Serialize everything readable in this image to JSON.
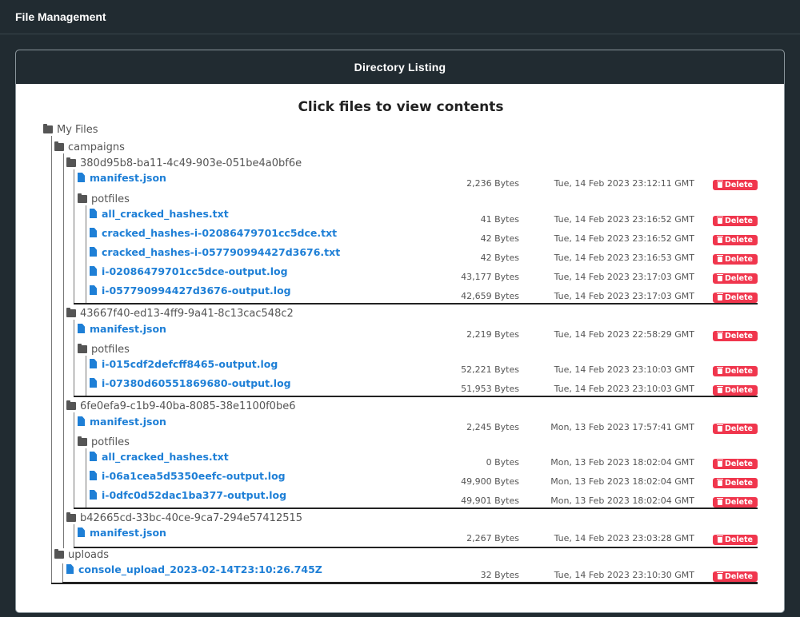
{
  "header": {
    "title": "File Management"
  },
  "card": {
    "title": "Directory Listing",
    "subtitle": "Click files to view contents"
  },
  "root": {
    "label": "My Files"
  },
  "campaigns": {
    "label": "campaigns"
  },
  "uploads": {
    "label": "uploads"
  },
  "delete_label": "Delete",
  "groups": [
    {
      "id": "380d95b8-ba11-4c49-903e-051be4a0bf6e",
      "manifest": {
        "name": "manifest.json",
        "size": "2,236 Bytes",
        "date": "Tue, 14 Feb 2023 23:12:11 GMT"
      },
      "potfiles_label": "potfiles",
      "files": [
        {
          "name": "all_cracked_hashes.txt",
          "size": "41 Bytes",
          "date": "Tue, 14 Feb 2023 23:16:52 GMT"
        },
        {
          "name": "cracked_hashes-i-02086479701cc5dce.txt",
          "size": "42 Bytes",
          "date": "Tue, 14 Feb 2023 23:16:52 GMT"
        },
        {
          "name": "cracked_hashes-i-057790994427d3676.txt",
          "size": "42 Bytes",
          "date": "Tue, 14 Feb 2023 23:16:53 GMT"
        },
        {
          "name": "i-02086479701cc5dce-output.log",
          "size": "43,177 Bytes",
          "date": "Tue, 14 Feb 2023 23:17:03 GMT"
        },
        {
          "name": "i-057790994427d3676-output.log",
          "size": "42,659 Bytes",
          "date": "Tue, 14 Feb 2023 23:17:03 GMT"
        }
      ]
    },
    {
      "id": "43667f40-ed13-4ff9-9a41-8c13cac548c2",
      "manifest": {
        "name": "manifest.json",
        "size": "2,219 Bytes",
        "date": "Tue, 14 Feb 2023 22:58:29 GMT"
      },
      "potfiles_label": "potfiles",
      "files": [
        {
          "name": "i-015cdf2defcff8465-output.log",
          "size": "52,221 Bytes",
          "date": "Tue, 14 Feb 2023 23:10:03 GMT"
        },
        {
          "name": "i-07380d60551869680-output.log",
          "size": "51,953 Bytes",
          "date": "Tue, 14 Feb 2023 23:10:03 GMT"
        }
      ]
    },
    {
      "id": "6fe0efa9-c1b9-40ba-8085-38e1100f0be6",
      "manifest": {
        "name": "manifest.json",
        "size": "2,245 Bytes",
        "date": "Mon, 13 Feb 2023 17:57:41 GMT"
      },
      "potfiles_label": "potfiles",
      "files": [
        {
          "name": "all_cracked_hashes.txt",
          "size": "0 Bytes",
          "date": "Mon, 13 Feb 2023 18:02:04 GMT"
        },
        {
          "name": "i-06a1cea5d5350eefc-output.log",
          "size": "49,900 Bytes",
          "date": "Mon, 13 Feb 2023 18:02:04 GMT"
        },
        {
          "name": "i-0dfc0d52dac1ba377-output.log",
          "size": "49,901 Bytes",
          "date": "Mon, 13 Feb 2023 18:02:04 GMT"
        }
      ]
    },
    {
      "id": "b42665cd-33bc-40ce-9ca7-294e57412515",
      "manifest": {
        "name": "manifest.json",
        "size": "2,267 Bytes",
        "date": "Tue, 14 Feb 2023 23:03:28 GMT"
      }
    }
  ],
  "upload_files": [
    {
      "name": "console_upload_2023-02-14T23:10:26.745Z",
      "size": "32 Bytes",
      "date": "Tue, 14 Feb 2023 23:10:30 GMT"
    }
  ]
}
